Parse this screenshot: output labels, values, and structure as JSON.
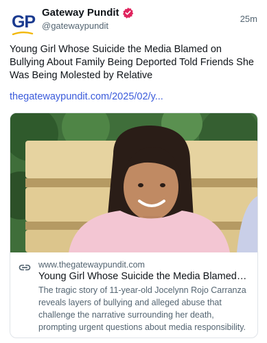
{
  "author": {
    "avatar_letters": "GP",
    "display_name": "Gateway Pundit",
    "handle": "@gatewaypundit",
    "verified_icon": "verified-badge-icon",
    "verified_color": "#e0245e"
  },
  "post": {
    "timestamp": "25m",
    "text": "Young Girl Whose Suicide the Media Blamed on Bullying About Family Being Deported Told Friends She Was Being Molested by Relative",
    "link": "thegatewaypundit.com/2025/02/y..."
  },
  "card": {
    "link_icon": "link-icon",
    "domain": "www.thegatewaypundit.com",
    "title": "Young Girl Whose Suicide the Media Blamed on Bullying About Family Being Deported Told Friends She Was Being Molested by Relative",
    "description": "The tragic story of 11-year-old Jocelynn Rojo Carranza reveals layers of bullying and alleged abuse that challenge the narrative surrounding her death, prompting urgent questions about media responsibility."
  },
  "colors": {
    "link": "#3b5bdb",
    "brand_blue": "#1a3a8f",
    "brand_gold": "#f2b705",
    "secondary_text": "#536471"
  }
}
